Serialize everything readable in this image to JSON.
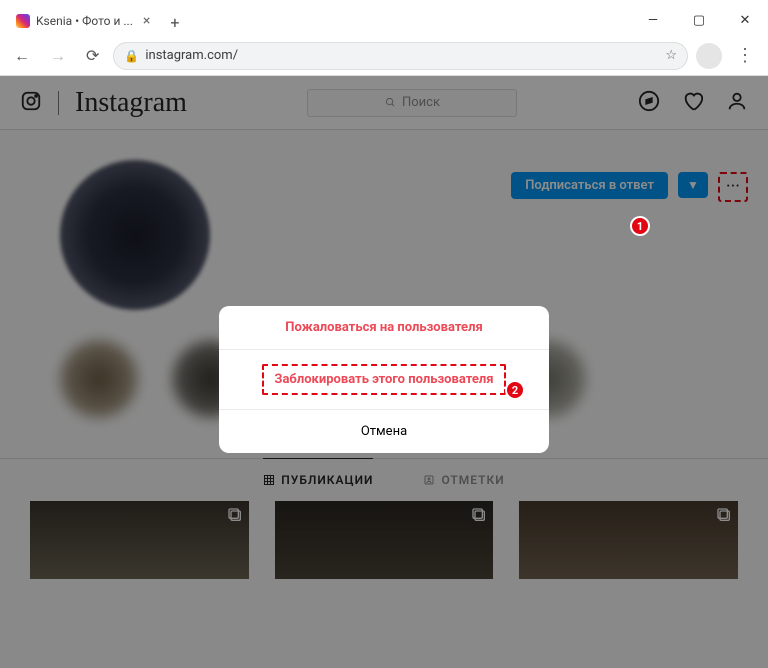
{
  "browser": {
    "tab_title": "Ksenia            • Фото и ...",
    "url": "instagram.com/",
    "window": {
      "min": "—",
      "max": "▢",
      "close": "✕"
    }
  },
  "ig": {
    "logo": "Instagram",
    "search_placeholder": "Поиск",
    "follow_btn": "Подписаться в ответ",
    "tabs": {
      "posts": "ПУБЛИКАЦИИ",
      "tagged": "ОТМЕТКИ"
    }
  },
  "modal": {
    "report": "Пожаловаться на пользователя",
    "block": "Заблокировать этого пользователя",
    "cancel": "Отмена"
  },
  "annotations": {
    "badge1": "1",
    "badge2": "2"
  }
}
